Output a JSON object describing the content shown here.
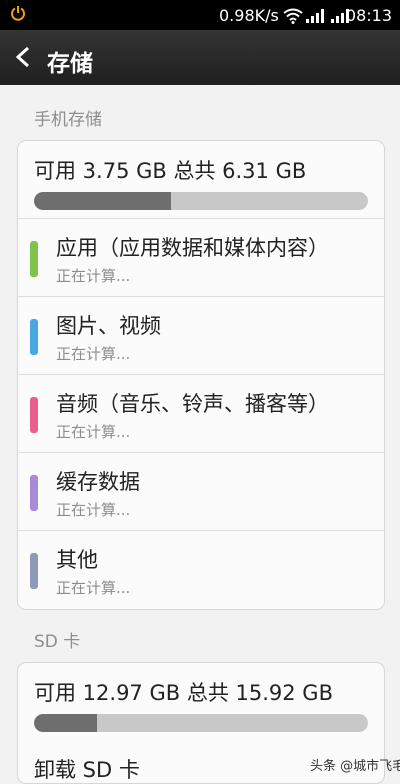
{
  "status_bar": {
    "network_speed": "0.98K/s",
    "time": "08:13"
  },
  "title_bar": {
    "title": "存储",
    "back_icon": "chevron-left-icon"
  },
  "phone_storage": {
    "section_label": "手机存储",
    "summary": "可用 3.75 GB  总共 6.31 GB",
    "available_gb": 3.75,
    "total_gb": 6.31,
    "used_fraction": 0.41,
    "items": [
      {
        "label": "应用（应用数据和媒体内容）",
        "status": "正在计算...",
        "color": "#7fc34a"
      },
      {
        "label": "图片、视频",
        "status": "正在计算...",
        "color": "#4aa8e0"
      },
      {
        "label": "音频（音乐、铃声、播客等）",
        "status": "正在计算...",
        "color": "#e8608a"
      },
      {
        "label": "缓存数据",
        "status": "正在计算...",
        "color": "#a98ad8"
      },
      {
        "label": "其他",
        "status": "正在计算...",
        "color": "#8f9ab8"
      }
    ]
  },
  "sd_card": {
    "section_label": "SD 卡",
    "summary": "可用 12.97 GB  总共 15.92 GB",
    "available_gb": 12.97,
    "total_gb": 15.92,
    "used_fraction": 0.19,
    "unmount_label": "卸载 SD 卡"
  },
  "watermark": "头条 @城市飞毛腿"
}
